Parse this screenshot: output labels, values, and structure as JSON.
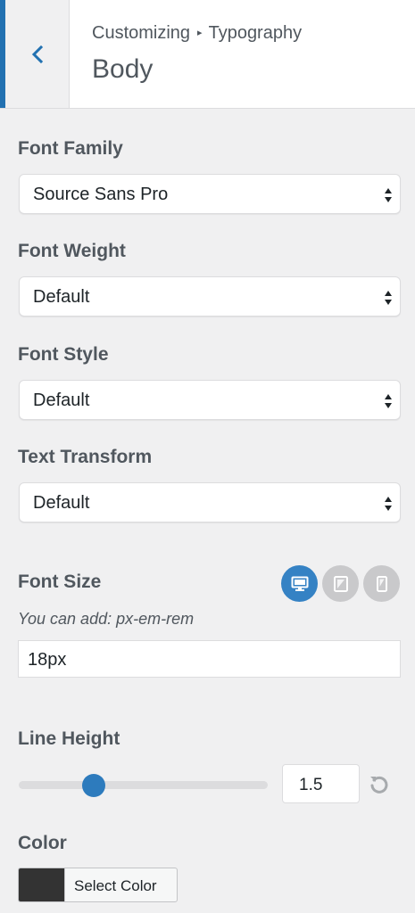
{
  "header": {
    "breadcrumb_parent": "Customizing",
    "breadcrumb_separator": "▸",
    "breadcrumb_current": "Typography",
    "title": "Body",
    "back_icon": "chevron-left-icon"
  },
  "controls": {
    "font_family": {
      "label": "Font Family",
      "value": "Source Sans Pro"
    },
    "font_weight": {
      "label": "Font Weight",
      "value": "Default"
    },
    "font_style": {
      "label": "Font Style",
      "value": "Default"
    },
    "text_transform": {
      "label": "Text Transform",
      "value": "Default"
    },
    "font_size": {
      "label": "Font Size",
      "hint": "You can add: px-em-rem",
      "value": "18px",
      "devices": [
        "desktop-icon",
        "tablet-icon",
        "mobile-icon"
      ],
      "active_device": "desktop"
    },
    "line_height": {
      "label": "Line Height",
      "value": "1.5",
      "slider_fraction": 0.3,
      "reset_icon": "reset-icon"
    },
    "color": {
      "label": "Color",
      "button_label": "Select Color",
      "swatch": "#333333"
    }
  },
  "colors": {
    "accent": "#2271b1",
    "active_device": "#3582c4",
    "slider_knob": "#2d7bbd"
  }
}
